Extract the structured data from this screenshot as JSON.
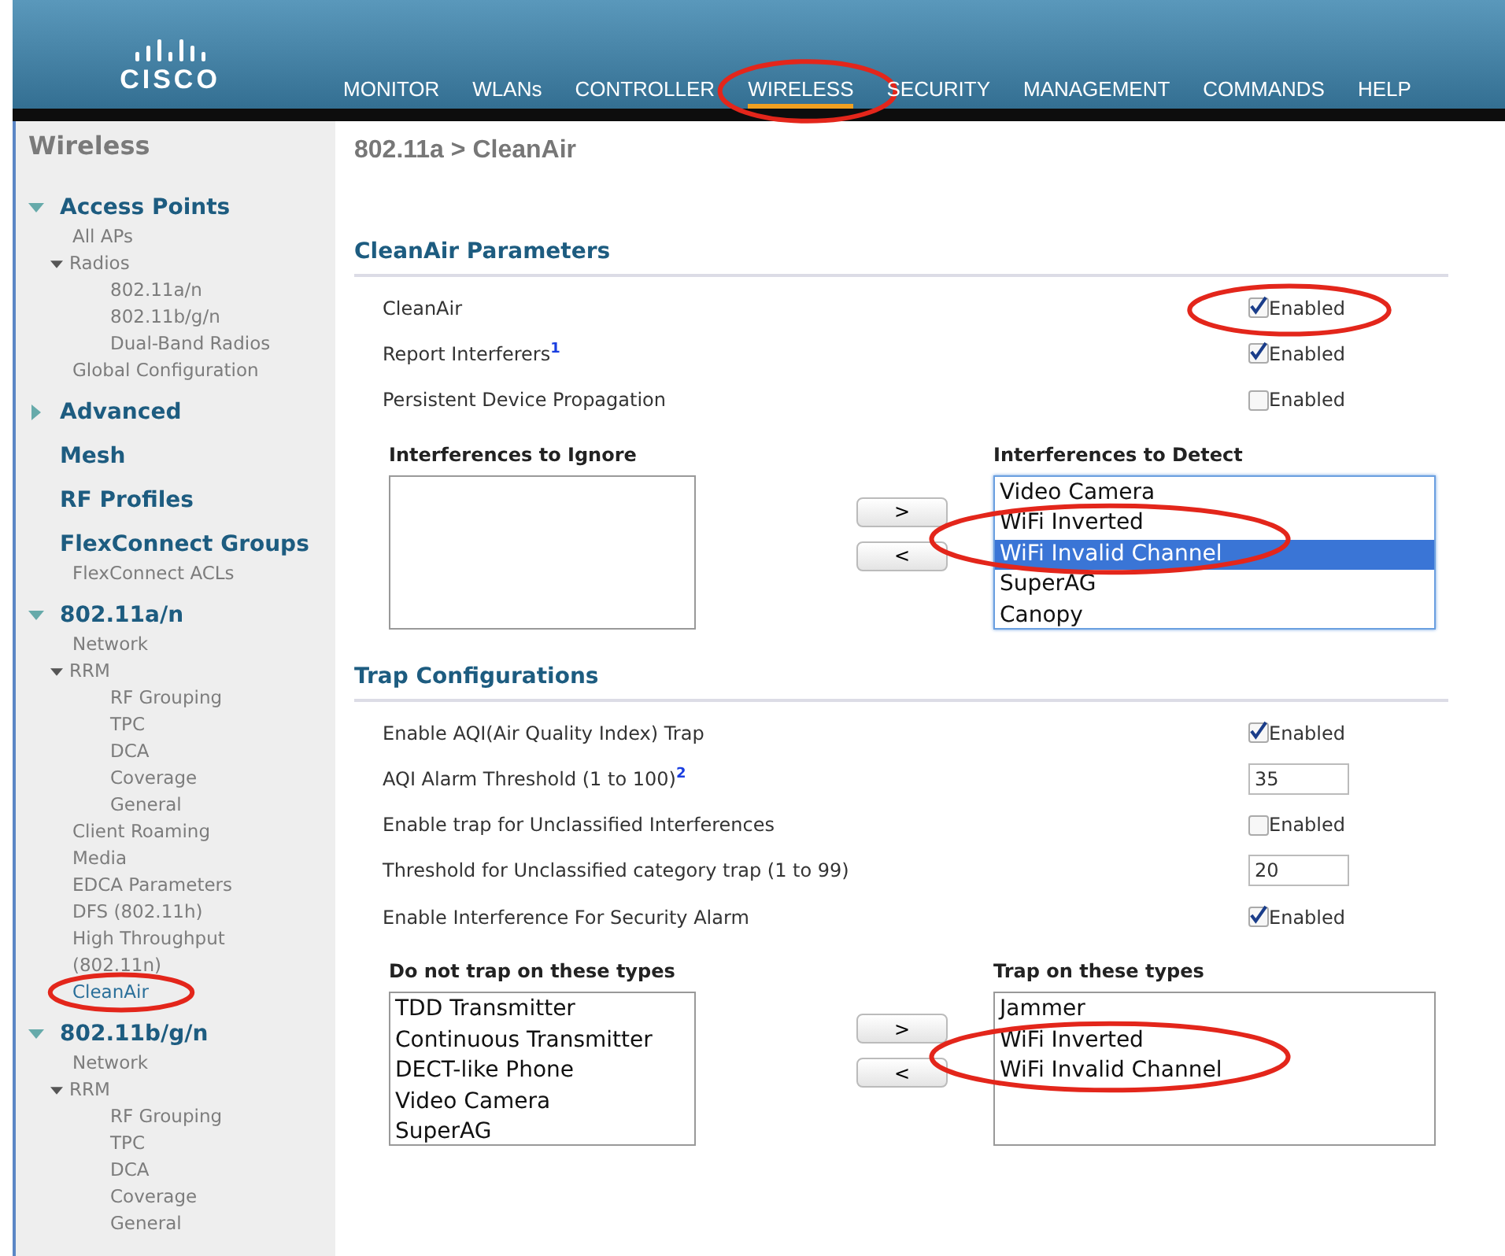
{
  "header": {
    "logo_text": "CISCO",
    "nav": [
      {
        "label": "MONITOR",
        "selected": false
      },
      {
        "label": "WLANs",
        "selected": false
      },
      {
        "label": "CONTROLLER",
        "selected": false
      },
      {
        "label": "WIRELESS",
        "selected": true,
        "circled": true
      },
      {
        "label": "SECURITY",
        "selected": false
      },
      {
        "label": "MANAGEMENT",
        "selected": false
      },
      {
        "label": "COMMANDS",
        "selected": false
      },
      {
        "label": "HELP",
        "selected": false
      }
    ]
  },
  "sidebar": {
    "title": "Wireless",
    "items": [
      {
        "label": "Access Points",
        "kind": "section",
        "expanded": true,
        "children": [
          {
            "label": "All APs"
          },
          {
            "label": "Radios",
            "expanded": true,
            "children": [
              {
                "label": "802.11a/n"
              },
              {
                "label": "802.11b/g/n"
              },
              {
                "label": "Dual-Band Radios"
              }
            ]
          },
          {
            "label": "Global Configuration"
          }
        ]
      },
      {
        "label": "Advanced",
        "kind": "section",
        "expanded": false
      },
      {
        "label": "Mesh",
        "kind": "section"
      },
      {
        "label": "RF Profiles",
        "kind": "section"
      },
      {
        "label": "FlexConnect Groups",
        "kind": "section",
        "children": [
          {
            "label": "FlexConnect ACLs"
          }
        ]
      },
      {
        "label": "802.11a/n",
        "kind": "section",
        "expanded": true,
        "children": [
          {
            "label": "Network"
          },
          {
            "label": "RRM",
            "expanded": true,
            "children": [
              {
                "label": "RF Grouping"
              },
              {
                "label": "TPC"
              },
              {
                "label": "DCA"
              },
              {
                "label": "Coverage"
              },
              {
                "label": "General"
              }
            ]
          },
          {
            "label": "Client Roaming"
          },
          {
            "label": "Media"
          },
          {
            "label": "EDCA Parameters"
          },
          {
            "label": "DFS (802.11h)"
          },
          {
            "label": "High Throughput (802.11n)"
          },
          {
            "label": "CleanAir",
            "selected": true,
            "circled": true
          }
        ]
      },
      {
        "label": "802.11b/g/n",
        "kind": "section",
        "expanded": true,
        "children": [
          {
            "label": "Network"
          },
          {
            "label": "RRM",
            "expanded": true,
            "children": [
              {
                "label": "RF Grouping"
              },
              {
                "label": "TPC"
              },
              {
                "label": "DCA"
              },
              {
                "label": "Coverage"
              },
              {
                "label": "General"
              }
            ]
          }
        ]
      }
    ]
  },
  "breadcrumb": "802.11a > CleanAir",
  "sections": [
    {
      "title": "CleanAir Parameters",
      "rows": [
        {
          "kind": "checkbox",
          "label": "CleanAir",
          "checked": true,
          "option": "Enabled",
          "circled": true
        },
        {
          "kind": "checkbox",
          "label": "Report Interferers",
          "note": "1",
          "checked": true,
          "option": "Enabled"
        },
        {
          "kind": "checkbox",
          "label": "Persistent Device Propagation",
          "checked": false,
          "option": "Enabled"
        }
      ],
      "lists": {
        "left": {
          "title": "Interferences to Ignore"
        },
        "right": {
          "title": "Interferences to Detect",
          "focused": true,
          "items": [
            {
              "label": "Video Camera",
              "selected": false
            },
            {
              "label": "WiFi Inverted",
              "selected": false,
              "circled": true
            },
            {
              "label": "WiFi Invalid Channel",
              "selected": true,
              "circled": true
            },
            {
              "label": "SuperAG",
              "selected": false
            },
            {
              "label": "Canopy",
              "selected": false
            }
          ]
        },
        "buttons": [
          ">",
          "<"
        ]
      }
    },
    {
      "title": "Trap Configurations",
      "rows": [
        {
          "kind": "checkbox",
          "label": "Enable AQI(Air Quality Index) Trap",
          "checked": true,
          "option": "Enabled"
        },
        {
          "kind": "input",
          "label": "AQI Alarm Threshold (1 to 100)",
          "note": "2",
          "value": "35"
        },
        {
          "kind": "checkbox",
          "label": "Enable trap for Unclassified Interferences",
          "checked": false,
          "option": "Enabled"
        },
        {
          "kind": "input",
          "label": "Threshold for Unclassified category trap (1 to 99)",
          "value": "20"
        },
        {
          "kind": "checkbox",
          "label": "Enable Interference For Security Alarm",
          "checked": true,
          "option": "Enabled"
        }
      ],
      "lists": {
        "left": {
          "title": "Do not trap on these types",
          "items": [
            {
              "label": "TDD Transmitter",
              "selected": false
            },
            {
              "label": "Continuous Transmitter",
              "selected": false
            },
            {
              "label": "DECT-like Phone",
              "selected": false
            },
            {
              "label": "Video Camera",
              "selected": false
            },
            {
              "label": "SuperAG",
              "selected": false
            }
          ]
        },
        "right": {
          "title": "Trap on these types",
          "focused": false,
          "items": [
            {
              "label": "Jammer",
              "selected": false
            },
            {
              "label": "WiFi Inverted",
              "selected": false,
              "circled": true
            },
            {
              "label": "WiFi Invalid Channel",
              "selected": false,
              "circled": true
            }
          ]
        },
        "buttons": [
          ">",
          "<"
        ]
      }
    }
  ]
}
